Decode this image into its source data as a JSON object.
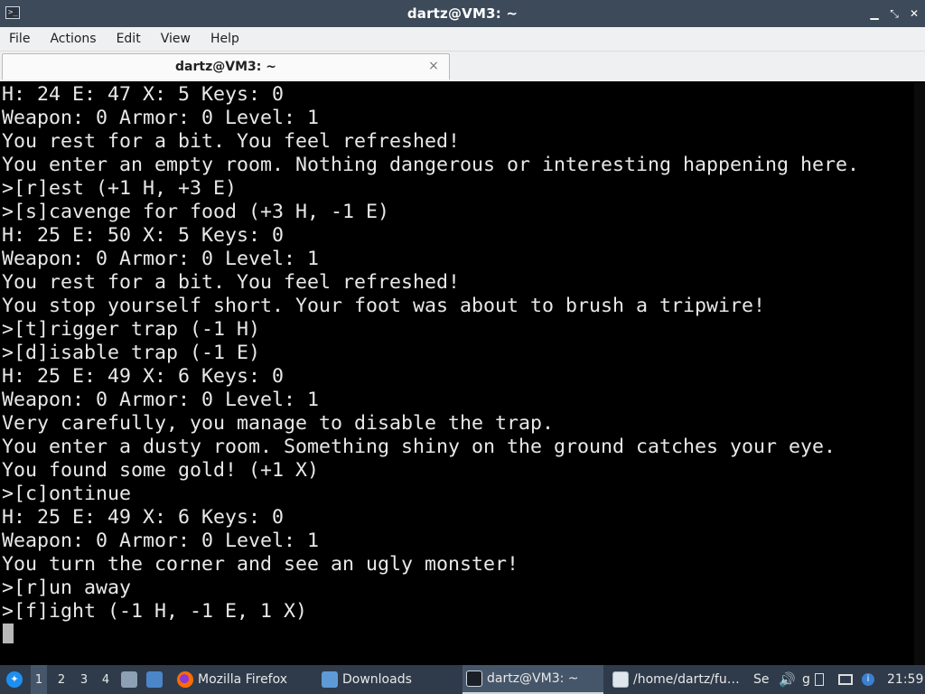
{
  "window": {
    "title": "dartz@VM3: ~",
    "app_icon": ">_"
  },
  "menu": [
    "File",
    "Actions",
    "Edit",
    "View",
    "Help"
  ],
  "tab": {
    "label": "dartz@VM3: ~",
    "close_glyph": "×"
  },
  "terminal": {
    "lines": [
      "H: 24 E: 47 X: 5 Keys: 0",
      "Weapon: 0 Armor: 0 Level: 1",
      "You rest for a bit. You feel refreshed!",
      "You enter an empty room. Nothing dangerous or interesting happening here.",
      ">[r]est (+1 H, +3 E)",
      ">[s]cavenge for food (+3 H, -1 E)",
      "H: 25 E: 50 X: 5 Keys: 0",
      "Weapon: 0 Armor: 0 Level: 1",
      "You rest for a bit. You feel refreshed!",
      "You stop yourself short. Your foot was about to brush a tripwire!",
      ">[t]rigger trap (-1 H)",
      ">[d]isable trap (-1 E)",
      "H: 25 E: 49 X: 6 Keys: 0",
      "Weapon: 0 Armor: 0 Level: 1",
      "Very carefully, you manage to disable the trap.",
      "You enter a dusty room. Something shiny on the ground catches your eye.",
      "You found some gold! (+1 X)",
      ">[c]ontinue",
      "H: 25 E: 49 X: 6 Keys: 0",
      "Weapon: 0 Armor: 0 Level: 1",
      "You turn the corner and see an ugly monster!",
      ">[r]un away",
      ">[f]ight (-1 H, -1 E, 1 X)"
    ]
  },
  "taskbar": {
    "workspaces": [
      "1",
      "2",
      "3",
      "4"
    ],
    "apps": [
      {
        "label": "Mozilla Firefox",
        "icon": "firefox-icon"
      },
      {
        "label": "Downloads",
        "icon": "folder-icon"
      },
      {
        "label": "dartz@VM3: ~",
        "icon": "terminal-icon"
      },
      {
        "label": "/home/dartz/fu…",
        "icon": "document-icon"
      }
    ],
    "tray_partial": "Se",
    "tray_partial2": "g",
    "clock": "21:59"
  }
}
